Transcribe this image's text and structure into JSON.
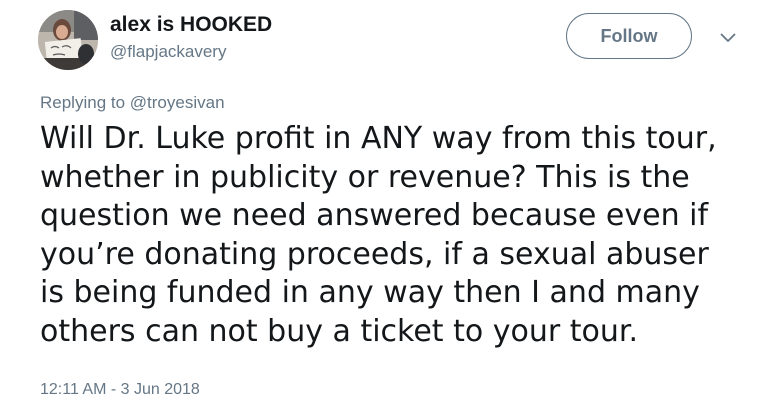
{
  "user": {
    "display_name": "alex is HOOKED",
    "username": "@flapjackavery",
    "avatar": "profile-photo"
  },
  "actions": {
    "follow_label": "Follow",
    "more_icon": "chevron-down-icon"
  },
  "reply": {
    "prefix": "Replying to ",
    "mention": "@troyesivan"
  },
  "tweet": {
    "lines": [
      "Will Dr. Luke profit in ANY way from this tour,",
      "whether in publicity or revenue? This is the",
      "question we need answered because even if",
      "you’re donating proceeds, if a sexual abuser",
      "is being funded in any way then I and many",
      "others can not buy a ticket to your tour."
    ],
    "timestamp": "12:11 AM - 3 Jun 2018"
  },
  "colors": {
    "text": "#14171a",
    "secondary": "#657786",
    "background": "#ffffff"
  }
}
